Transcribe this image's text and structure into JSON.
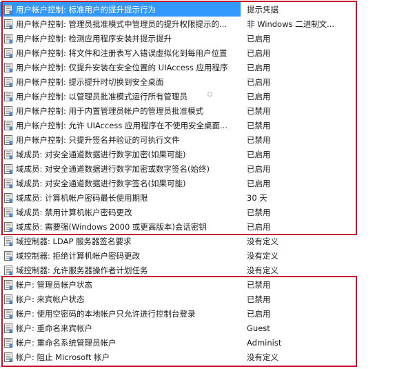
{
  "policies": [
    {
      "name": "用户帐户控制: 标准用户的提升提示行为",
      "value": "提示凭据",
      "selected": true
    },
    {
      "name": "用户帐户控制: 管理员批准模式中管理员的提升权限提示的...",
      "value": "非 Windows 二进制文..."
    },
    {
      "name": "用户帐户控制: 检测应用程序安装并提示提升",
      "value": "已启用"
    },
    {
      "name": "用户帐户控制: 将文件和注册表写入错误虚拟化到每用户位置",
      "value": "已启用"
    },
    {
      "name": "用户帐户控制: 仅提升安装在安全位置的 UIAccess 应用程序",
      "value": "已启用"
    },
    {
      "name": "用户帐户控制: 提示提升时切换到安全桌面",
      "value": "已启用"
    },
    {
      "name": "用户帐户控制: 以管理员批准模式运行所有管理员",
      "value": "已启用"
    },
    {
      "name": "用户帐户控制: 用于内置管理员帐户的管理员批准模式",
      "value": "已禁用"
    },
    {
      "name": "用户帐户控制: 允许 UIAccess 应用程序在不使用安全桌面...",
      "value": "已禁用"
    },
    {
      "name": "用户帐户控制: 只提升签名并验证的可执行文件",
      "value": "已禁用"
    },
    {
      "name": "域成员: 对安全通道数据进行数字加密(如果可能)",
      "value": "已启用"
    },
    {
      "name": "域成员: 对安全通道数据进行数字加密或数字签名(始终)",
      "value": "已启用"
    },
    {
      "name": "域成员: 对安全通道数据进行数字签名(如果可能)",
      "value": "已启用"
    },
    {
      "name": "域成员: 计算机帐户密码最长使用期限",
      "value": "30 天"
    },
    {
      "name": "域成员: 禁用计算机帐户密码更改",
      "value": "已禁用"
    },
    {
      "name": "域成员: 需要强(Windows 2000 或更高版本)会话密钥",
      "value": "已启用"
    },
    {
      "name": "域控制器: LDAP 服务器签名要求",
      "value": "没有定义"
    },
    {
      "name": "域控制器: 拒绝计算机帐户密码更改",
      "value": "没有定义"
    },
    {
      "name": "域控制器: 允许服务器操作者计划任务",
      "value": "没有定义"
    },
    {
      "name": "帐户: 管理员帐户状态",
      "value": "已禁用"
    },
    {
      "name": "帐户: 来宾帐户状态",
      "value": "已禁用"
    },
    {
      "name": "帐户: 使用空密码的本地帐户只允许进行控制台登录",
      "value": "已启用"
    },
    {
      "name": "帐户: 重命名来宾帐户",
      "value": "Guest"
    },
    {
      "name": "帐户: 重命名系统管理员帐户",
      "value": "Administ"
    },
    {
      "name": "帐户: 阻止 Microsoft 帐户",
      "value": "没有定义"
    }
  ],
  "colors": {
    "highlight_box": "#c8102e",
    "selection": "#3399ff"
  },
  "icon": "policy-setting-icon"
}
